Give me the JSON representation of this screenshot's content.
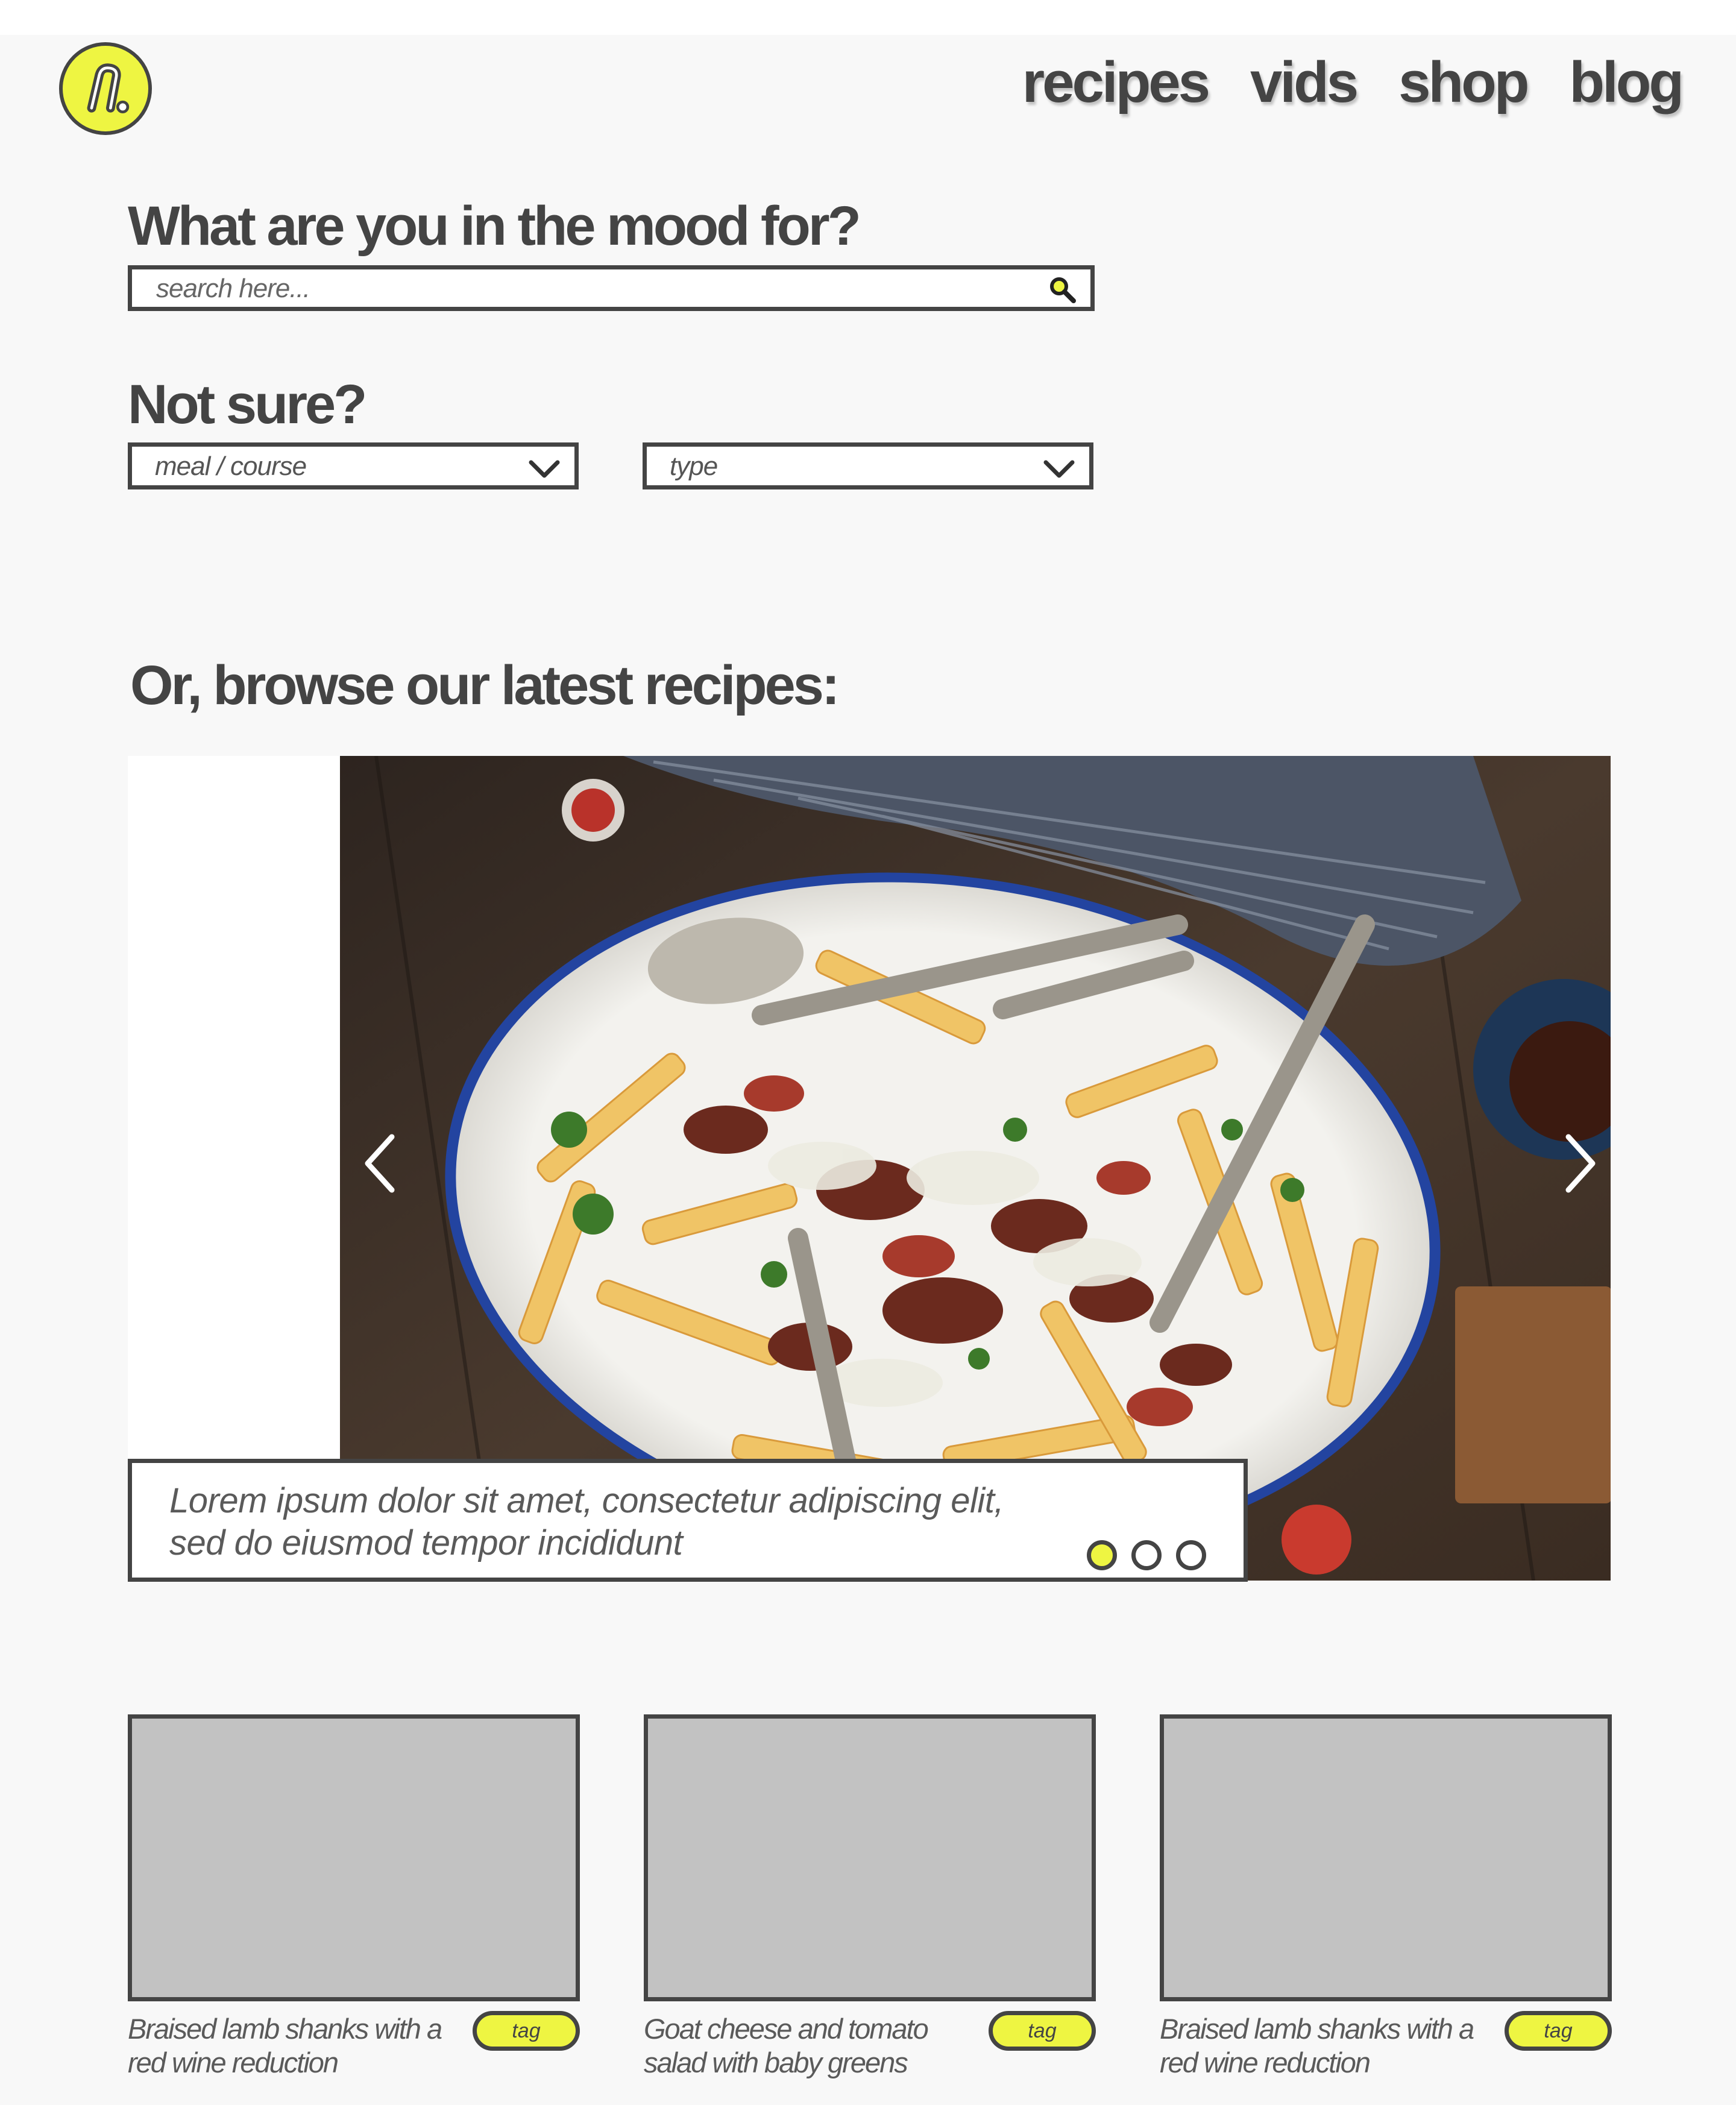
{
  "header": {
    "logo_text": "n.",
    "nav": [
      {
        "label": "recipes",
        "active": true
      },
      {
        "label": "vids",
        "active": false
      },
      {
        "label": "shop",
        "active": false
      },
      {
        "label": "blog",
        "active": false
      }
    ]
  },
  "search": {
    "heading": "What are you in the mood for?",
    "placeholder": "search here..."
  },
  "filters": {
    "heading": "Not sure?",
    "meal_course": "meal / course",
    "type": "type"
  },
  "browse": {
    "heading": "Or, browse our latest recipes:",
    "caption": "Lorem ipsum dolor sit amet, consectetur adipiscing elit, sed do eiusmod tempor incididunt",
    "slide_count": 3,
    "active_slide": 1
  },
  "cards": [
    {
      "title": "Braised lamb shanks with a red wine reduction",
      "tag": "tag"
    },
    {
      "title": "Goat cheese and tomato salad with baby greens",
      "tag": "tag"
    },
    {
      "title": "Braised lamb shanks with a red wine reduction",
      "tag": "tag"
    }
  ],
  "colors": {
    "accent": "#eef542",
    "ink": "#444444",
    "background": "#f8f8f8",
    "card_placeholder": "#c2c2c2"
  },
  "icons": [
    "logo-mark",
    "search-icon",
    "chevron-down-icon",
    "chevron-left-icon",
    "chevron-right-icon"
  ]
}
